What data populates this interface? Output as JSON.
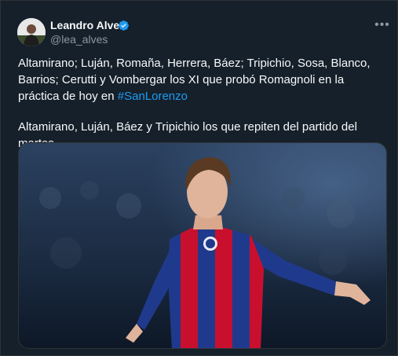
{
  "author": {
    "display_name": "Leandro Alves",
    "handle": "@lea_alves",
    "verified_icon": "verified-badge-icon",
    "avatar_icon": "avatar-photo"
  },
  "menu": {
    "icon": "more-options-icon"
  },
  "tweet": {
    "paragraph1_text": "Altamirano; Luján, Romaña, Herrera, Báez; Tripichio, Sosa, Blanco, Barrios; Cerutti y Vombergar los XI que probó Romagnoli en la práctica de hoy en ",
    "hashtag": "#SanLorenzo",
    "paragraph2_text": "Altamirano, Luján, Báez y Tripichio los que repiten del partido del martes."
  },
  "media": {
    "kind": "photo",
    "subject": "player-celebrating-photo"
  },
  "colors": {
    "background": "#15202b",
    "text": "#f7f9f9",
    "secondary": "#8b98a5",
    "link": "#1d9bf0",
    "shirt_blue": "#1f3a8c",
    "shirt_red": "#c8102e"
  }
}
